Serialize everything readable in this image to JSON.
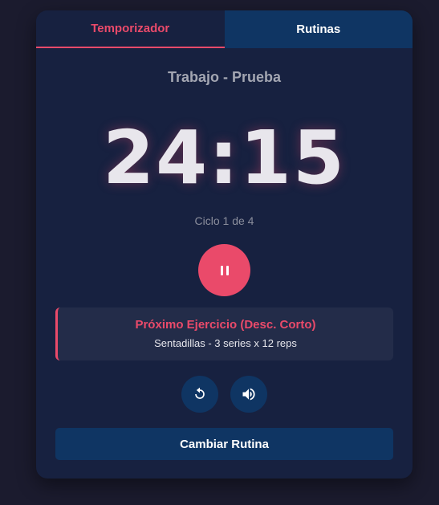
{
  "tabs": [
    {
      "label": "Temporizador",
      "active": true
    },
    {
      "label": "Rutinas",
      "active": false
    }
  ],
  "timer": {
    "subtitle": "Trabajo - Prueba",
    "time": "24:15",
    "cycle": "Ciclo 1 de 4"
  },
  "controls": {
    "play_pause_icon": "pause-icon",
    "reset_icon": "restart-icon",
    "sound_icon": "volume-icon"
  },
  "next_exercise": {
    "title": "Próximo Ejercicio (Desc. Corto)",
    "detail": "Sentadillas - 3 series x 12 reps"
  },
  "change_routine_label": "Cambiar Rutina",
  "colors": {
    "background": "#1b1b2e",
    "card": "#172140",
    "accent": "#ea4a6a",
    "button": "#0f3563",
    "panel": "#232c49"
  }
}
